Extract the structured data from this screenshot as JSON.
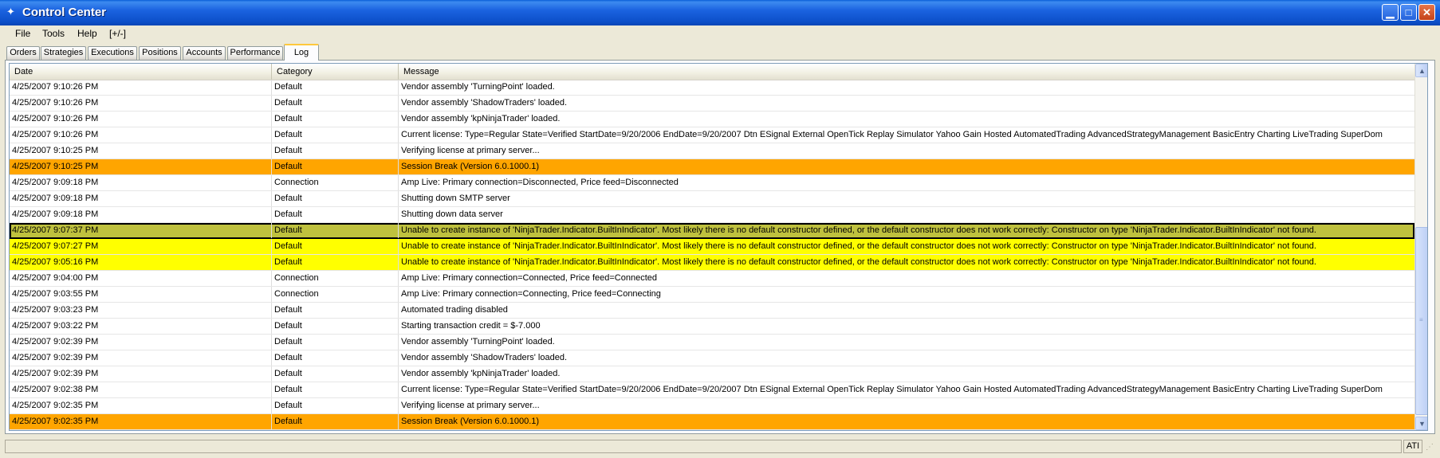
{
  "window": {
    "title": "Control Center"
  },
  "menu": [
    "File",
    "Tools",
    "Help",
    "[+/-]"
  ],
  "tabs": [
    {
      "label": "Orders",
      "active": false
    },
    {
      "label": "Strategies",
      "active": false
    },
    {
      "label": "Executions",
      "active": false
    },
    {
      "label": "Positions",
      "active": false
    },
    {
      "label": "Accounts",
      "active": false
    },
    {
      "label": "Performance",
      "active": false
    },
    {
      "label": "Log",
      "active": true
    }
  ],
  "columns": {
    "date": "Date",
    "category": "Category",
    "message": "Message"
  },
  "colors": {
    "session_break": "#FFA500",
    "error": "#FFFF00",
    "selected": "#BFC13E"
  },
  "rows": [
    {
      "date": "4/25/2007 9:10:26 PM",
      "category": "Default",
      "message": "Vendor assembly 'TurningPoint' loaded.",
      "style": ""
    },
    {
      "date": "4/25/2007 9:10:26 PM",
      "category": "Default",
      "message": "Vendor assembly 'ShadowTraders' loaded.",
      "style": ""
    },
    {
      "date": "4/25/2007 9:10:26 PM",
      "category": "Default",
      "message": "Vendor assembly 'kpNinjaTrader' loaded.",
      "style": ""
    },
    {
      "date": "4/25/2007 9:10:26 PM",
      "category": "Default",
      "message": "Current license: Type=Regular State=Verified StartDate=9/20/2006 EndDate=9/20/2007 Dtn ESignal External OpenTick Replay Simulator Yahoo Gain Hosted AutomatedTrading AdvancedStrategyManagement BasicEntry Charting LiveTrading SuperDom",
      "style": ""
    },
    {
      "date": "4/25/2007 9:10:25 PM",
      "category": "Default",
      "message": "Verifying license at primary server...",
      "style": ""
    },
    {
      "date": "4/25/2007 9:10:25 PM",
      "category": "Default",
      "message": "Session Break (Version 6.0.1000.1)",
      "style": "orange"
    },
    {
      "date": "4/25/2007 9:09:18 PM",
      "category": "Connection",
      "message": "Amp Live: Primary connection=Disconnected, Price feed=Disconnected",
      "style": ""
    },
    {
      "date": "4/25/2007 9:09:18 PM",
      "category": "Default",
      "message": "Shutting down SMTP server",
      "style": ""
    },
    {
      "date": "4/25/2007 9:09:18 PM",
      "category": "Default",
      "message": "Shutting down data server",
      "style": ""
    },
    {
      "date": "4/25/2007 9:07:37 PM",
      "category": "Default",
      "message": "Unable to create instance of 'NinjaTrader.Indicator.BuiltInIndicator'. Most likely there is no default constructor defined, or the default constructor does not work correctly: Constructor on type 'NinjaTrader.Indicator.BuiltInIndicator' not found.",
      "style": "selected"
    },
    {
      "date": "4/25/2007 9:07:27 PM",
      "category": "Default",
      "message": "Unable to create instance of 'NinjaTrader.Indicator.BuiltInIndicator'. Most likely there is no default constructor defined, or the default constructor does not work correctly: Constructor on type 'NinjaTrader.Indicator.BuiltInIndicator' not found.",
      "style": "yellow"
    },
    {
      "date": "4/25/2007 9:05:16 PM",
      "category": "Default",
      "message": "Unable to create instance of 'NinjaTrader.Indicator.BuiltInIndicator'. Most likely there is no default constructor defined, or the default constructor does not work correctly: Constructor on type 'NinjaTrader.Indicator.BuiltInIndicator' not found.",
      "style": "yellow"
    },
    {
      "date": "4/25/2007 9:04:00 PM",
      "category": "Connection",
      "message": "Amp Live: Primary connection=Connected, Price feed=Connected",
      "style": ""
    },
    {
      "date": "4/25/2007 9:03:55 PM",
      "category": "Connection",
      "message": "Amp Live: Primary connection=Connecting, Price feed=Connecting",
      "style": ""
    },
    {
      "date": "4/25/2007 9:03:23 PM",
      "category": "Default",
      "message": "Automated trading disabled",
      "style": ""
    },
    {
      "date": "4/25/2007 9:03:22 PM",
      "category": "Default",
      "message": "Starting transaction credit = $-7.000",
      "style": ""
    },
    {
      "date": "4/25/2007 9:02:39 PM",
      "category": "Default",
      "message": "Vendor assembly 'TurningPoint' loaded.",
      "style": ""
    },
    {
      "date": "4/25/2007 9:02:39 PM",
      "category": "Default",
      "message": "Vendor assembly 'ShadowTraders' loaded.",
      "style": ""
    },
    {
      "date": "4/25/2007 9:02:39 PM",
      "category": "Default",
      "message": "Vendor assembly 'kpNinjaTrader' loaded.",
      "style": ""
    },
    {
      "date": "4/25/2007 9:02:38 PM",
      "category": "Default",
      "message": "Current license: Type=Regular State=Verified StartDate=9/20/2006 EndDate=9/20/2007 Dtn ESignal External OpenTick Replay Simulator Yahoo Gain Hosted AutomatedTrading AdvancedStrategyManagement BasicEntry Charting LiveTrading SuperDom",
      "style": ""
    },
    {
      "date": "4/25/2007 9:02:35 PM",
      "category": "Default",
      "message": "Verifying license at primary server...",
      "style": ""
    },
    {
      "date": "4/25/2007 9:02:35 PM",
      "category": "Default",
      "message": "Session Break (Version 6.0.1000.1)",
      "style": "orange"
    }
  ],
  "status": {
    "right": "ATI"
  }
}
